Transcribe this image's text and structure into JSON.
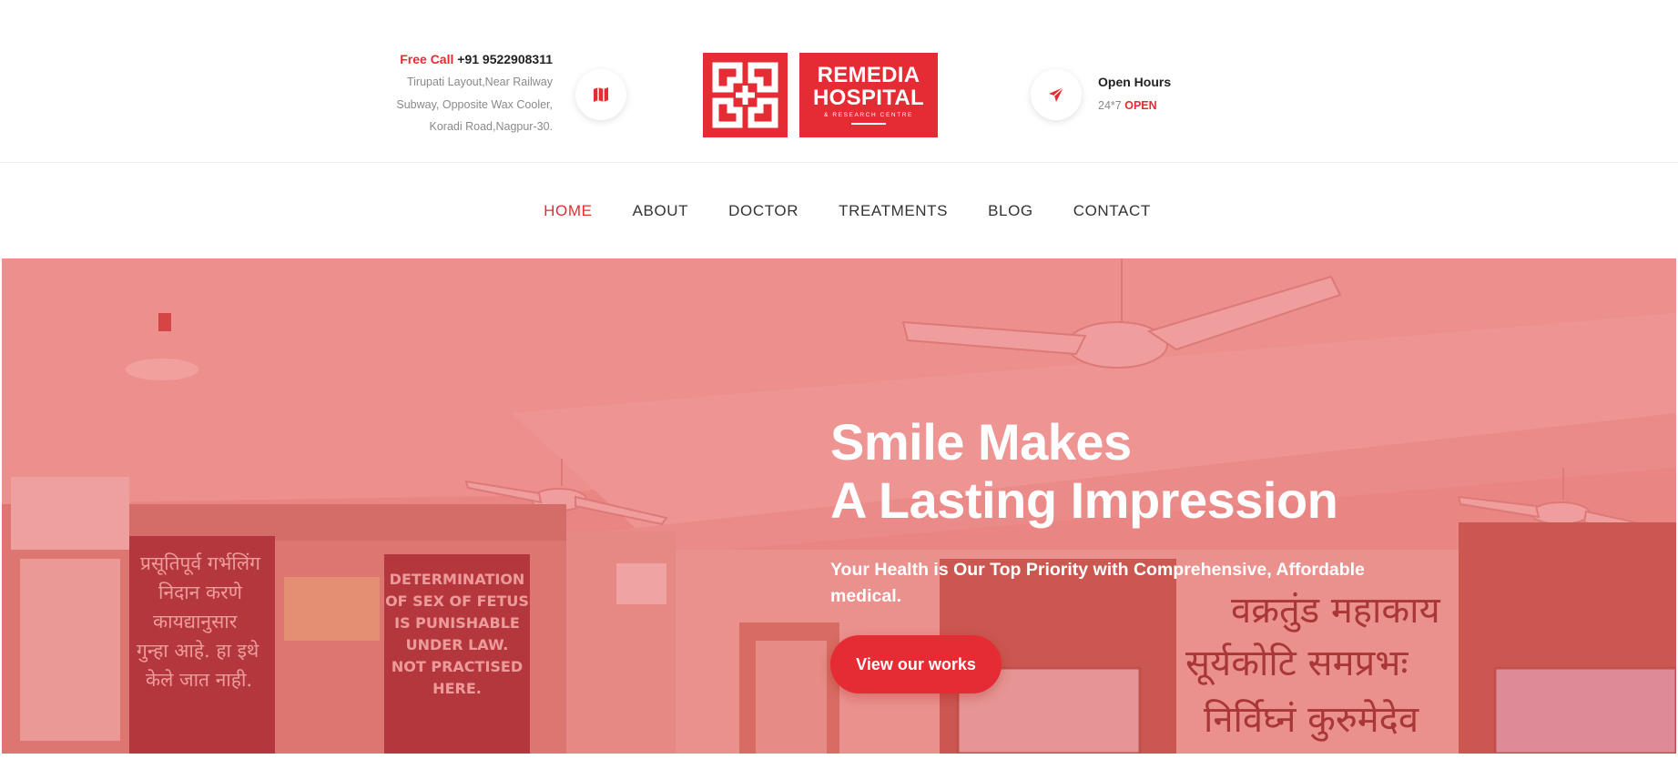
{
  "header": {
    "contact": {
      "free_call_label": "Free Call",
      "phone": "+91 9522908311",
      "address_lines": [
        "Tirupati Layout,Near Railway",
        "Subway, Opposite Wax Cooler,",
        "Koradi Road,Nagpur-30."
      ]
    },
    "logo": {
      "line1": "REMEDIA",
      "line2": "HOSPITAL",
      "line3": "& RESEARCH CENTRE"
    },
    "hours": {
      "title": "Open Hours",
      "time": "24*7",
      "status": "OPEN"
    },
    "icons": {
      "map": "map-icon",
      "send": "paper-plane-icon"
    }
  },
  "nav": {
    "items": [
      {
        "label": "HOME",
        "active": true
      },
      {
        "label": "ABOUT",
        "active": false
      },
      {
        "label": "DOCTOR",
        "active": false
      },
      {
        "label": "TREATMENTS",
        "active": false
      },
      {
        "label": "BLOG",
        "active": false
      },
      {
        "label": "CONTACT",
        "active": false
      }
    ]
  },
  "hero": {
    "title_line1": "Smile Makes",
    "title_line2": "A Lasting Impression",
    "subtitle": "Your Health is Our Top Priority with Comprehensive, Affordable medical.",
    "button": "View our works",
    "photo_signs": {
      "left_sign": [
        "प्रसूतिपूर्व गर्भलिंग",
        "निदान करणे",
        "कायद्यानुसार",
        "गुन्हा आहे. हा इथे",
        "केले जात नाही."
      ],
      "right_sign": [
        "DETERMINATION",
        "OF SEX OF FETUS",
        "IS PUNISHABLE",
        "UNDER LAW.",
        "NOT PRACTISED",
        "HERE."
      ],
      "wall_text": [
        "वक्रतुंड महाकाय",
        "सूर्यकोटि समप्रभः",
        "निर्विघ्नं कुरुमेदेव"
      ]
    }
  },
  "colors": {
    "accent": "#e52b33",
    "overlay": "#e24648",
    "text_dark": "#222222",
    "text_muted": "#8a8a8a"
  }
}
